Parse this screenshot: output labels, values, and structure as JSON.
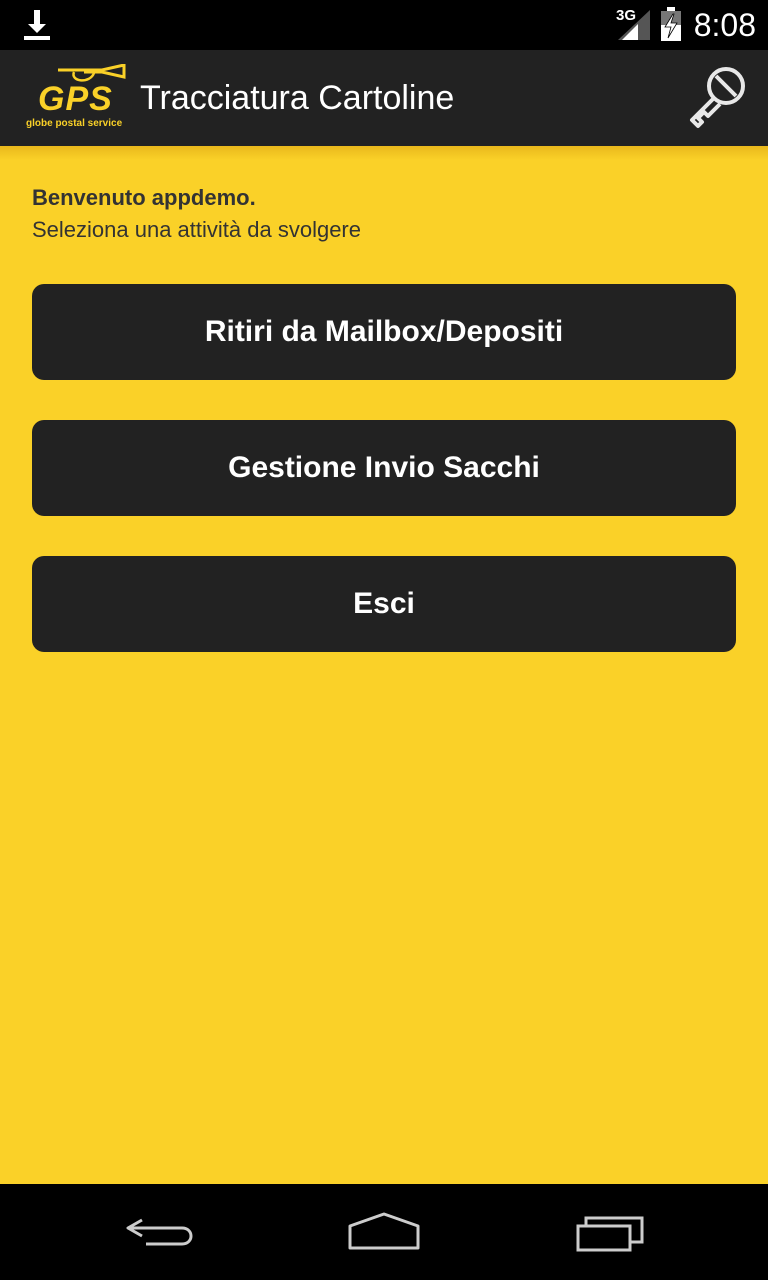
{
  "status_bar": {
    "network": "3G",
    "time": "8:08",
    "icons": [
      "download-icon",
      "signal-icon",
      "battery-charging-icon"
    ]
  },
  "action_bar": {
    "logo_text": "GPS",
    "logo_subtitle": "globe postal service",
    "title": "Tracciatura Cartoline",
    "action_icon": "key-icon"
  },
  "welcome": {
    "greeting": "Benvenuto appdemo.",
    "instruction": "Seleziona una attività da svolgere"
  },
  "menu": {
    "items": [
      {
        "label": "Ritiri da Mailbox/Depositi"
      },
      {
        "label": "Gestione Invio Sacchi"
      },
      {
        "label": "Esci"
      }
    ]
  },
  "nav_bar": {
    "icons": [
      "back-icon",
      "home-icon",
      "recent-apps-icon"
    ]
  },
  "colors": {
    "background": "#fad128",
    "bar": "#222222",
    "button": "#222222",
    "button_text": "#ffffff"
  }
}
